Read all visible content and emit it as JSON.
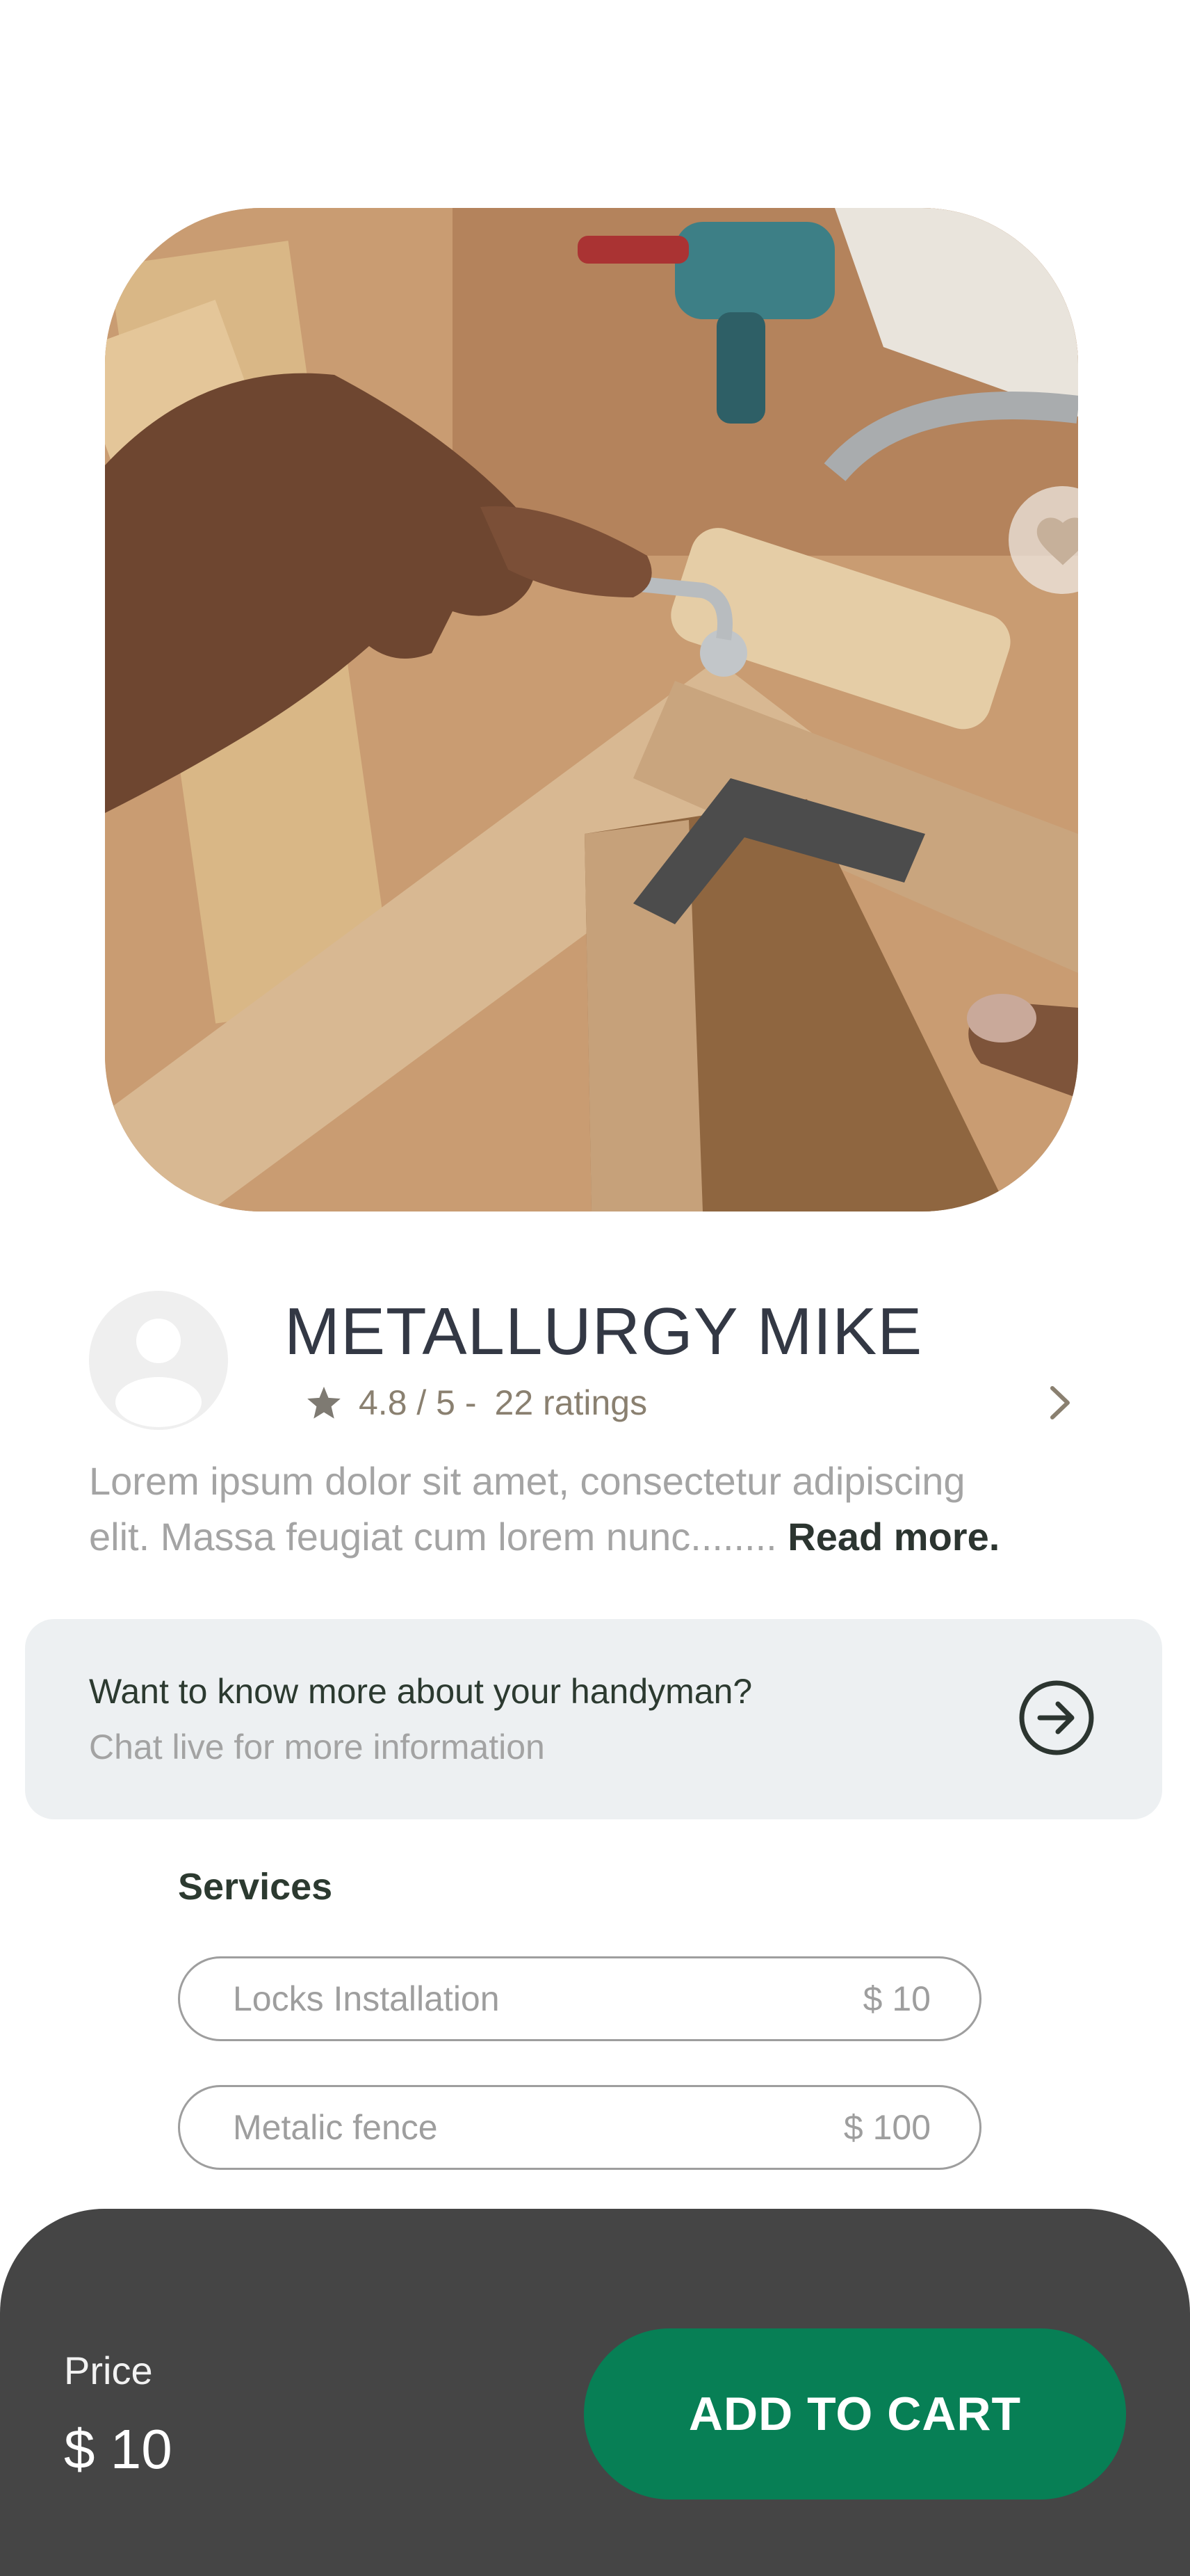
{
  "product": {
    "image_alt": "Hands assembling wooden furniture with metal hook and bracket",
    "favorite_icon": "heart-icon"
  },
  "profile": {
    "name": "METALLURGY MIKE",
    "rating_text": "4.8 / 5 -",
    "ratings_count": "22 ratings",
    "description_line1": "Lorem ipsum dolor sit amet, consectetur adipiscing",
    "description_line2": "elit. Massa feugiat cum lorem nunc........",
    "read_more": "Read more."
  },
  "chat": {
    "title": "Want to know more about your handyman?",
    "subtitle": "Chat live for more information",
    "icon": "arrow-right-circle-icon"
  },
  "services": {
    "title": "Services",
    "items": [
      {
        "name": "Locks Installation",
        "price": "$ 10"
      },
      {
        "name": "Metalic fence",
        "price": "$ 100"
      }
    ]
  },
  "bottom": {
    "price_label": "Price",
    "price_value": "$ 10",
    "cta": "ADD TO CART"
  },
  "colors": {
    "accent": "#077f55",
    "bottom_bar": "#454545",
    "card_bg": "#edf0f2",
    "rating": "#8a8070"
  }
}
